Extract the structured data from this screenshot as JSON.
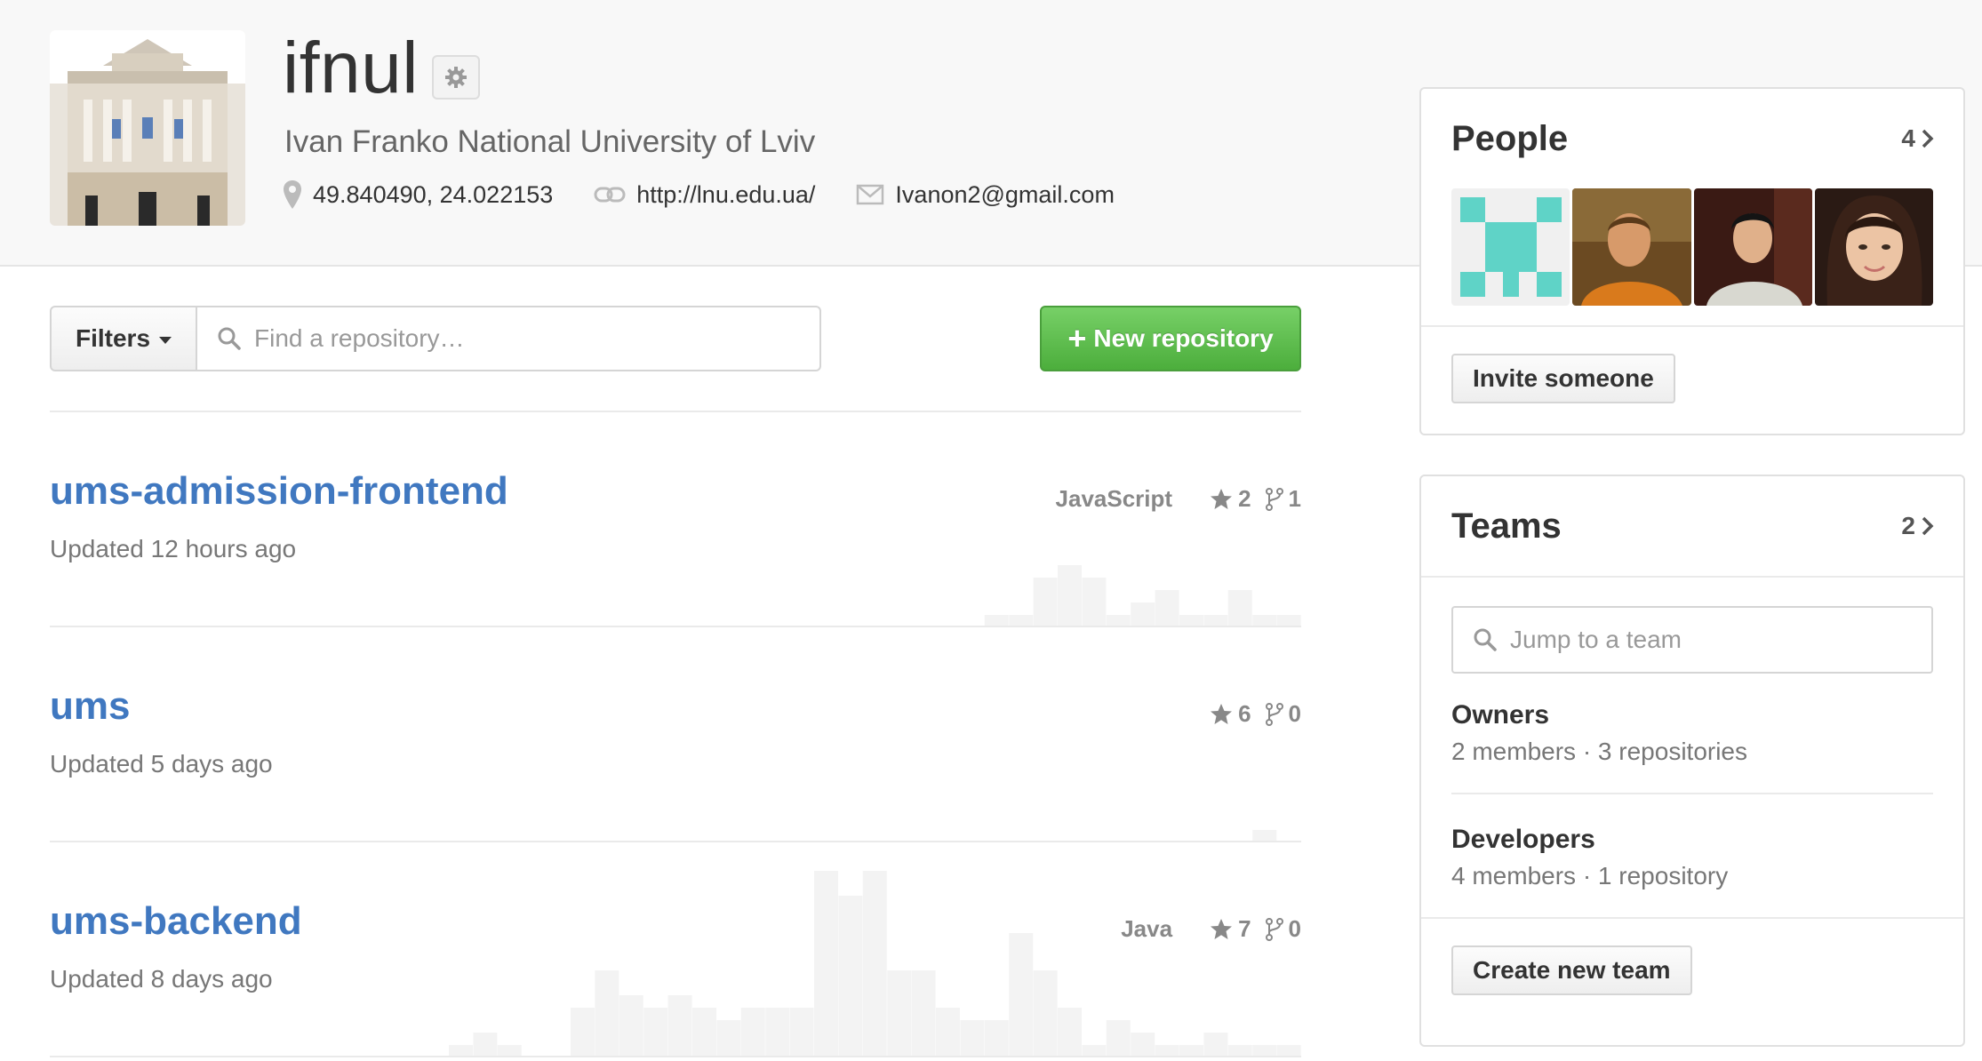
{
  "org": {
    "login": "ifnul",
    "full_name": "Ivan Franko National University of Lviv",
    "location": "49.840490, 24.022153",
    "website": "http://lnu.edu.ua/",
    "email": "Ivanon2@gmail.com"
  },
  "toolbar": {
    "filters_label": "Filters",
    "search_placeholder": "Find a repository…",
    "new_repo_label": "New repository"
  },
  "repositories": [
    {
      "name": "ums-admission-frontend",
      "updated": "Updated 12 hours ago",
      "language": "JavaScript",
      "stars": "2",
      "forks": "1",
      "activity": [
        0,
        0,
        0,
        0,
        0,
        0,
        0,
        0,
        0,
        0,
        0,
        0,
        0,
        0,
        0,
        0,
        0,
        0,
        0,
        0,
        0,
        0,
        0,
        0,
        0,
        0,
        0,
        0,
        0,
        0,
        0,
        0,
        0,
        0,
        0,
        0,
        0,
        1,
        1,
        4,
        5,
        4,
        1,
        2,
        3,
        1,
        1,
        3,
        1,
        1
      ]
    },
    {
      "name": "ums",
      "updated": "Updated 5 days ago",
      "language": "",
      "stars": "6",
      "forks": "0",
      "activity": [
        0,
        0,
        0,
        0,
        0,
        0,
        0,
        0,
        0,
        0,
        0,
        0,
        0,
        0,
        0,
        0,
        0,
        0,
        0,
        0,
        0,
        0,
        0,
        0,
        0,
        0,
        0,
        0,
        0,
        0,
        0,
        0,
        0,
        0,
        0,
        0,
        0,
        0,
        0,
        0,
        0,
        0,
        0,
        0,
        0,
        0,
        0,
        0,
        1,
        0
      ]
    },
    {
      "name": "ums-backend",
      "updated": "Updated 8 days ago",
      "language": "Java",
      "stars": "7",
      "forks": "0",
      "activity": [
        0,
        0,
        0,
        0,
        0,
        0,
        0,
        0,
        0,
        0,
        0,
        0,
        0,
        0,
        0,
        1,
        2,
        1,
        0,
        0,
        4,
        7,
        5,
        4,
        5,
        4,
        3,
        4,
        4,
        4,
        15,
        13,
        15,
        7,
        7,
        4,
        3,
        3,
        10,
        7,
        4,
        1,
        3,
        2,
        1,
        1,
        2,
        1,
        1,
        1
      ]
    }
  ],
  "people": {
    "title": "People",
    "count": "4",
    "invite_label": "Invite someone"
  },
  "teams": {
    "title": "Teams",
    "count": "2",
    "search_placeholder": "Jump to a team",
    "items": [
      {
        "name": "Owners",
        "info": "2 members · 3 repositories"
      },
      {
        "name": "Developers",
        "info": "4 members · 1 repository"
      }
    ],
    "create_label": "Create new team"
  },
  "colors": {
    "link": "#4078c0",
    "green_button": "#55b544",
    "identicon": "#5fd3c7"
  }
}
